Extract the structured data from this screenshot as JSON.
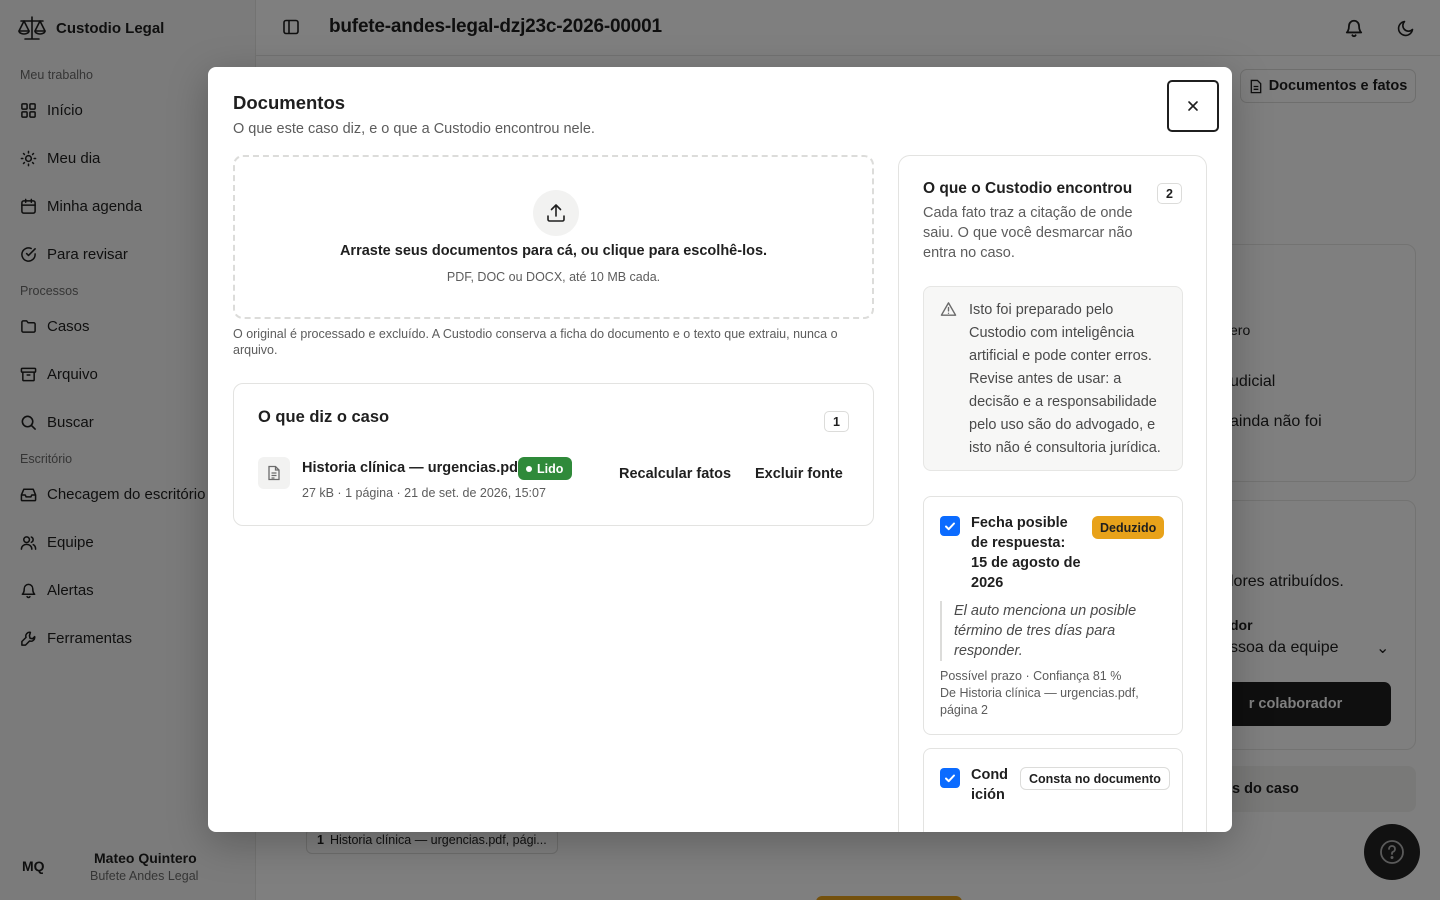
{
  "app": {
    "name": "Custodio Legal"
  },
  "sidebar": {
    "sections": [
      {
        "label": "Meu trabalho"
      },
      {
        "label": "Processos"
      },
      {
        "label": "Escritório"
      }
    ],
    "items": [
      {
        "label": "Início",
        "icon": "grid-icon"
      },
      {
        "label": "Meu dia",
        "icon": "sun-icon"
      },
      {
        "label": "Minha agenda",
        "icon": "calendar-icon"
      },
      {
        "label": "Para revisar",
        "icon": "check-circle-icon"
      },
      {
        "label": "Casos",
        "icon": "folder-icon"
      },
      {
        "label": "Arquivo",
        "icon": "archive-icon"
      },
      {
        "label": "Buscar",
        "icon": "search-icon"
      },
      {
        "label": "Checagem do escritório",
        "icon": "inbox-icon"
      },
      {
        "label": "Equipe",
        "icon": "users-icon"
      },
      {
        "label": "Alertas",
        "icon": "bell-icon"
      },
      {
        "label": "Ferramentas",
        "icon": "wrench-icon"
      }
    ],
    "user": {
      "initials": "MQ",
      "name": "Mateo Quintero",
      "firm": "Bufete Andes Legal"
    }
  },
  "topbar": {
    "title": "bufete-andes-legal-dzj23c-2026-00001"
  },
  "background": {
    "docs_button": "Documentos e fatos",
    "fragments": [
      "ero",
      "udicial",
      "ainda não foi",
      "lores atribuídos.",
      "dor",
      "ssoa da equipe"
    ],
    "button": "r colaborador",
    "bar": "s do caso",
    "chip": {
      "num": "1",
      "text": "Historia clínica — urgencias.pdf, pági..."
    }
  },
  "modal": {
    "title": "Documentos",
    "subtitle": "O que este caso diz, e o que a Custodio encontrou nele.",
    "dropzone": {
      "main": "Arraste seus documentos para cá, ou clique para escolhê-los.",
      "hint": "PDF, DOC ou DOCX, até 10 MB cada."
    },
    "note": "O original é processado e excluído. A Custodio conserva a ficha do documento e o texto que extraiu, nunca o arquivo.",
    "case": {
      "title": "O que diz o caso",
      "count": "1",
      "file": {
        "name": "Historia clínica — urgencias.pdf",
        "status": "Lido",
        "meta": "27 kB · 1 página · 21 de set. de 2026, 15:07"
      },
      "recalc": "Recalcular fatos",
      "delete": "Excluir fonte"
    },
    "facts": {
      "title": "O que o Custodio encontrou",
      "count": "2",
      "subtitle": "Cada fato traz a citação de onde saiu. O que você desmarcar não entra no caso.",
      "warning": "Isto foi preparado pelo Custodio com inteligência artificial e pode conter erros. Revise antes de usar: a decisão e a responsabilidade pelo uso são do advogado, e isto não é consultoria jurídica.",
      "items": [
        {
          "title": "Fecha posible de respuesta: 15 de agosto de 2026",
          "tag": "Deduzido",
          "quote": "El auto menciona un posible término de tres días para responder.",
          "meta": "Possível prazo · Confiança 81 %",
          "source": "De Historia clínica — urgencias.pdf, página 2",
          "checked": true
        },
        {
          "title": "Condición",
          "tag": "Consta no documento",
          "checked": true
        }
      ]
    }
  },
  "colors": {
    "accent": "#0b6bff",
    "deduced": "#e8a21a",
    "read": "#2f8a3a"
  }
}
